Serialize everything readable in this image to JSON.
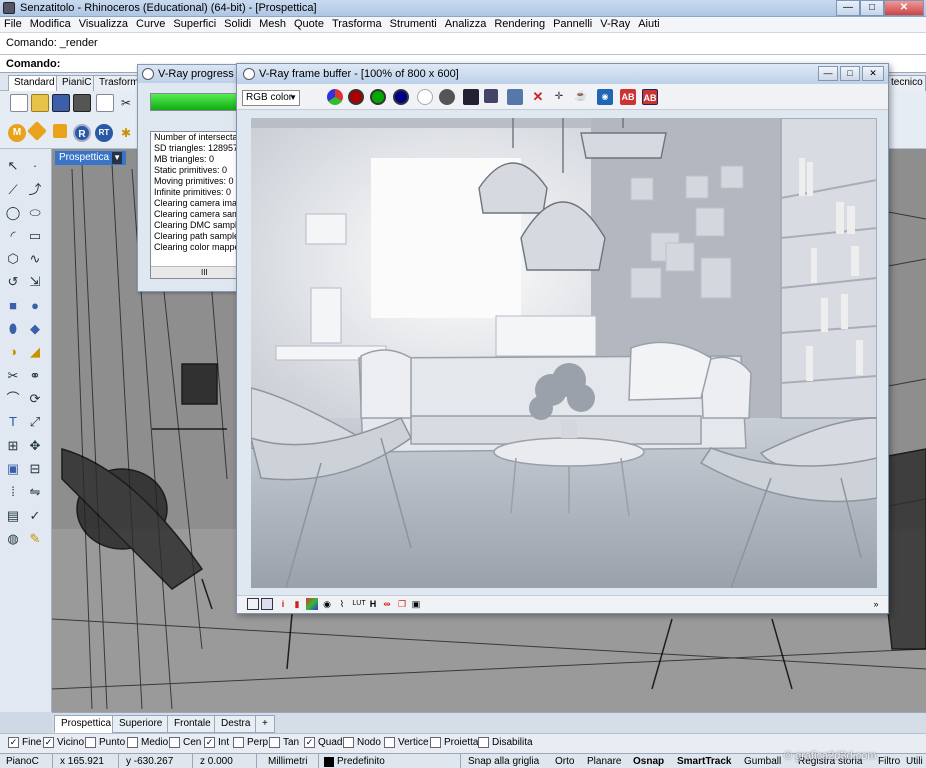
{
  "app": {
    "title": "Senzatitolo - Rhinoceros (Educational) (64-bit) - [Prospettica]",
    "controls": {
      "minimize": "—",
      "maximize": "□",
      "close": "✕"
    }
  },
  "menu": [
    "File",
    "Modifica",
    "Visualizza",
    "Curve",
    "Superfici",
    "Solidi",
    "Mesh",
    "Quote",
    "Trasforma",
    "Strumenti",
    "Analizza",
    "Rendering",
    "Pannelli",
    "V-Ray",
    "Aiuti"
  ],
  "command": {
    "history": "Comando: _render",
    "prompt": "Comando:"
  },
  "toolbar_tabs": [
    "Standard",
    "PianiC",
    "Trasforma"
  ],
  "toolbar_tab_right": "tecnico",
  "viewport": {
    "label": "Prospettica",
    "tabs": [
      "Prospettica",
      "Superiore",
      "Frontale",
      "Destra"
    ],
    "add_tab": "+"
  },
  "progress_window": {
    "title": "V-Ray progress wi",
    "progress_fraction": 1.0,
    "log": [
      "Number of intersectab",
      "SD triangles: 1289570",
      "MB triangles: 0",
      "Static primitives: 0",
      "Moving primitives: 0",
      "Infinite primitives: 0",
      "Clearing camera image",
      "Clearing camera samp",
      "Clearing DMC sampler",
      "Clearing path sampler",
      "Clearing color mapper"
    ],
    "scroll_mark": "III"
  },
  "frame_buffer": {
    "title": "V-Ray frame buffer - [100% of 800 x 600]",
    "channel": "RGB color",
    "bottom_icon_labels": [
      "i",
      "LUT",
      "H"
    ]
  },
  "osnap": [
    {
      "label": "Fine",
      "checked": true
    },
    {
      "label": "Vicino",
      "checked": true
    },
    {
      "label": "Punto",
      "checked": false
    },
    {
      "label": "Medio",
      "checked": false
    },
    {
      "label": "Cen",
      "checked": false
    },
    {
      "label": "Int",
      "checked": true
    },
    {
      "label": "Perp",
      "checked": false
    },
    {
      "label": "Tan",
      "checked": false
    },
    {
      "label": "Quad",
      "checked": true
    },
    {
      "label": "Nodo",
      "checked": false
    },
    {
      "label": "Vertice",
      "checked": false
    },
    {
      "label": "Proietta",
      "checked": false
    },
    {
      "label": "Disabilita",
      "checked": false
    }
  ],
  "status": {
    "plane": "PianoC",
    "x": "x 165.921",
    "y": "y -630.267",
    "z": "z 0.000",
    "units": "Millimetri",
    "layer": "Predefinito",
    "grid_snap": "Snap alla griglia",
    "ortho": "Orto",
    "planar": "Planare",
    "osnap": "Osnap",
    "smarttrack": "SmartTrack",
    "gumball": "Gumball",
    "history": "Registra storia",
    "filter": "Filtro",
    "last": "Utili"
  },
  "watermark": "© grafica2d3d.com",
  "colors": {
    "accent": "#3a74c9",
    "progress_green": "#22b022",
    "close_red": "#c94444"
  }
}
